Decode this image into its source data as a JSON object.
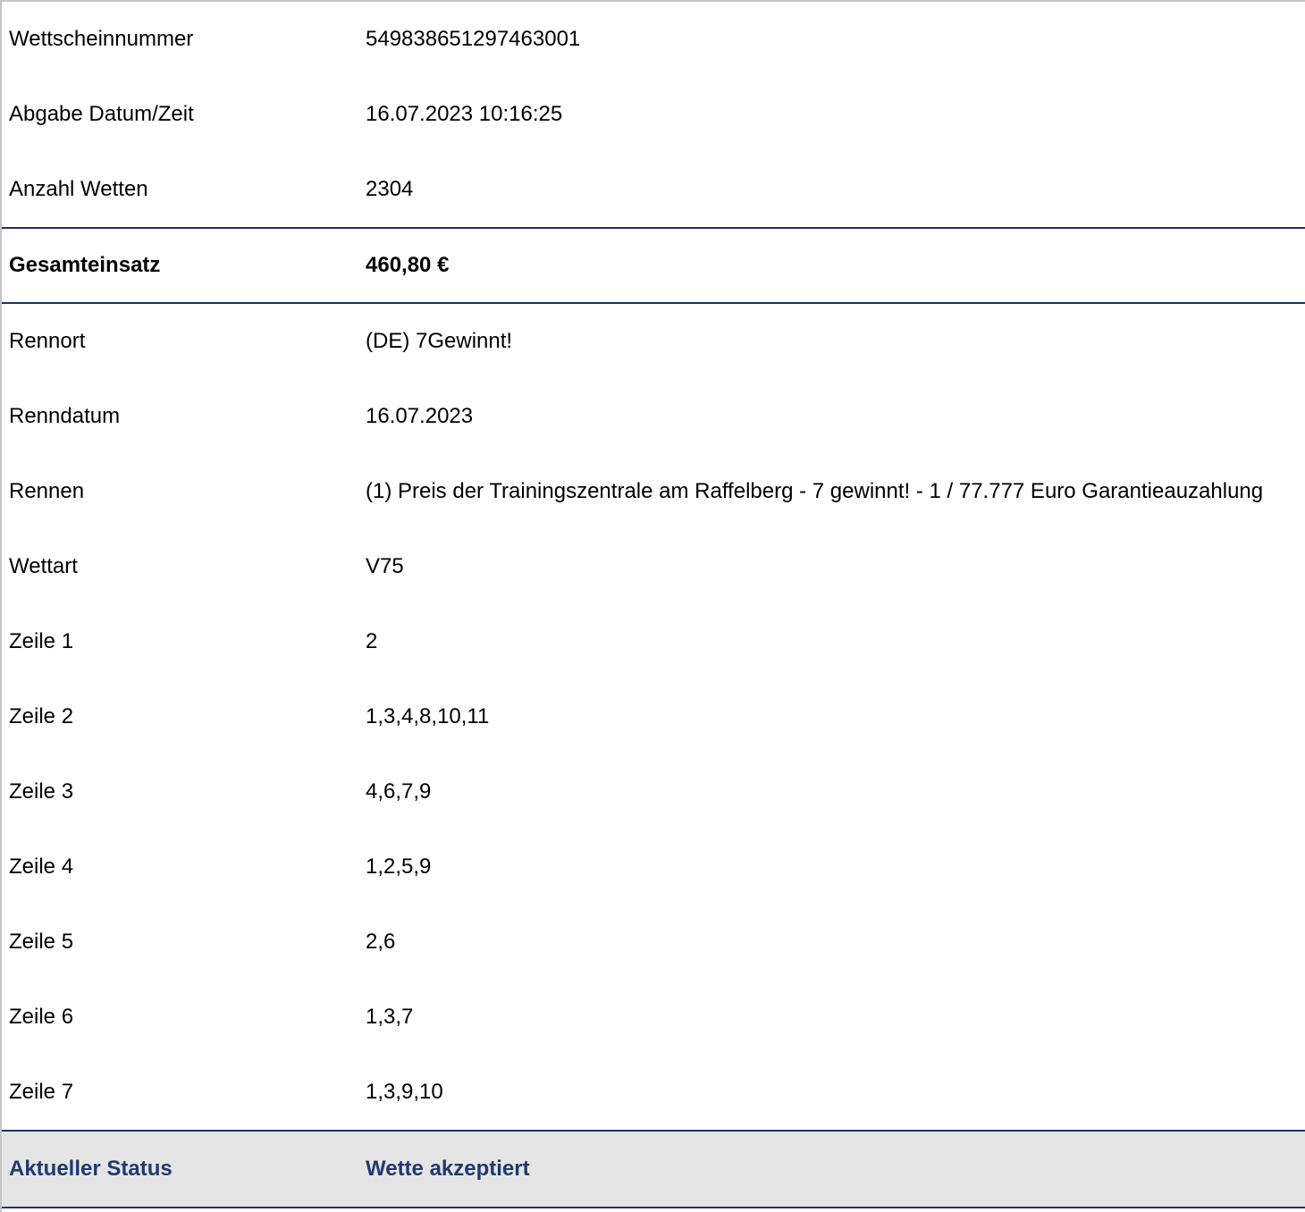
{
  "ticket": {
    "head_rows": [
      {
        "label": "Wettscheinnummer",
        "value": "549838651297463001"
      },
      {
        "label": "Abgabe Datum/Zeit",
        "value": "16.07.2023 10:16:25"
      },
      {
        "label": "Anzahl Wetten",
        "value": "2304"
      }
    ],
    "total": {
      "label": "Gesamteinsatz",
      "value": "460,80 €"
    },
    "detail_rows": [
      {
        "label": "Rennort",
        "value": "(DE) 7Gewinnt!"
      },
      {
        "label": "Renndatum",
        "value": "16.07.2023"
      },
      {
        "label": "Rennen",
        "value": "(1) Preis der Trainingszentrale am Raffelberg - 7 gewinnt! - 1 / 77.777 Euro Garantieauzahlung"
      },
      {
        "label": "Wettart",
        "value": "V75"
      },
      {
        "label": "Zeile 1",
        "value": "2"
      },
      {
        "label": "Zeile 2",
        "value": "1,3,4,8,10,11"
      },
      {
        "label": "Zeile 3",
        "value": "4,6,7,9"
      },
      {
        "label": "Zeile 4",
        "value": "1,2,5,9"
      },
      {
        "label": "Zeile 5",
        "value": "2,6"
      },
      {
        "label": "Zeile 6",
        "value": "1,3,7"
      },
      {
        "label": "Zeile 7",
        "value": "1,3,9,10"
      }
    ],
    "status": {
      "label": "Aktueller Status",
      "value": "Wette akzeptiert"
    }
  },
  "colors": {
    "accent": "#1f3a6e",
    "status_background": "#e5e5e5",
    "outer_border": "#c4c4c4"
  }
}
